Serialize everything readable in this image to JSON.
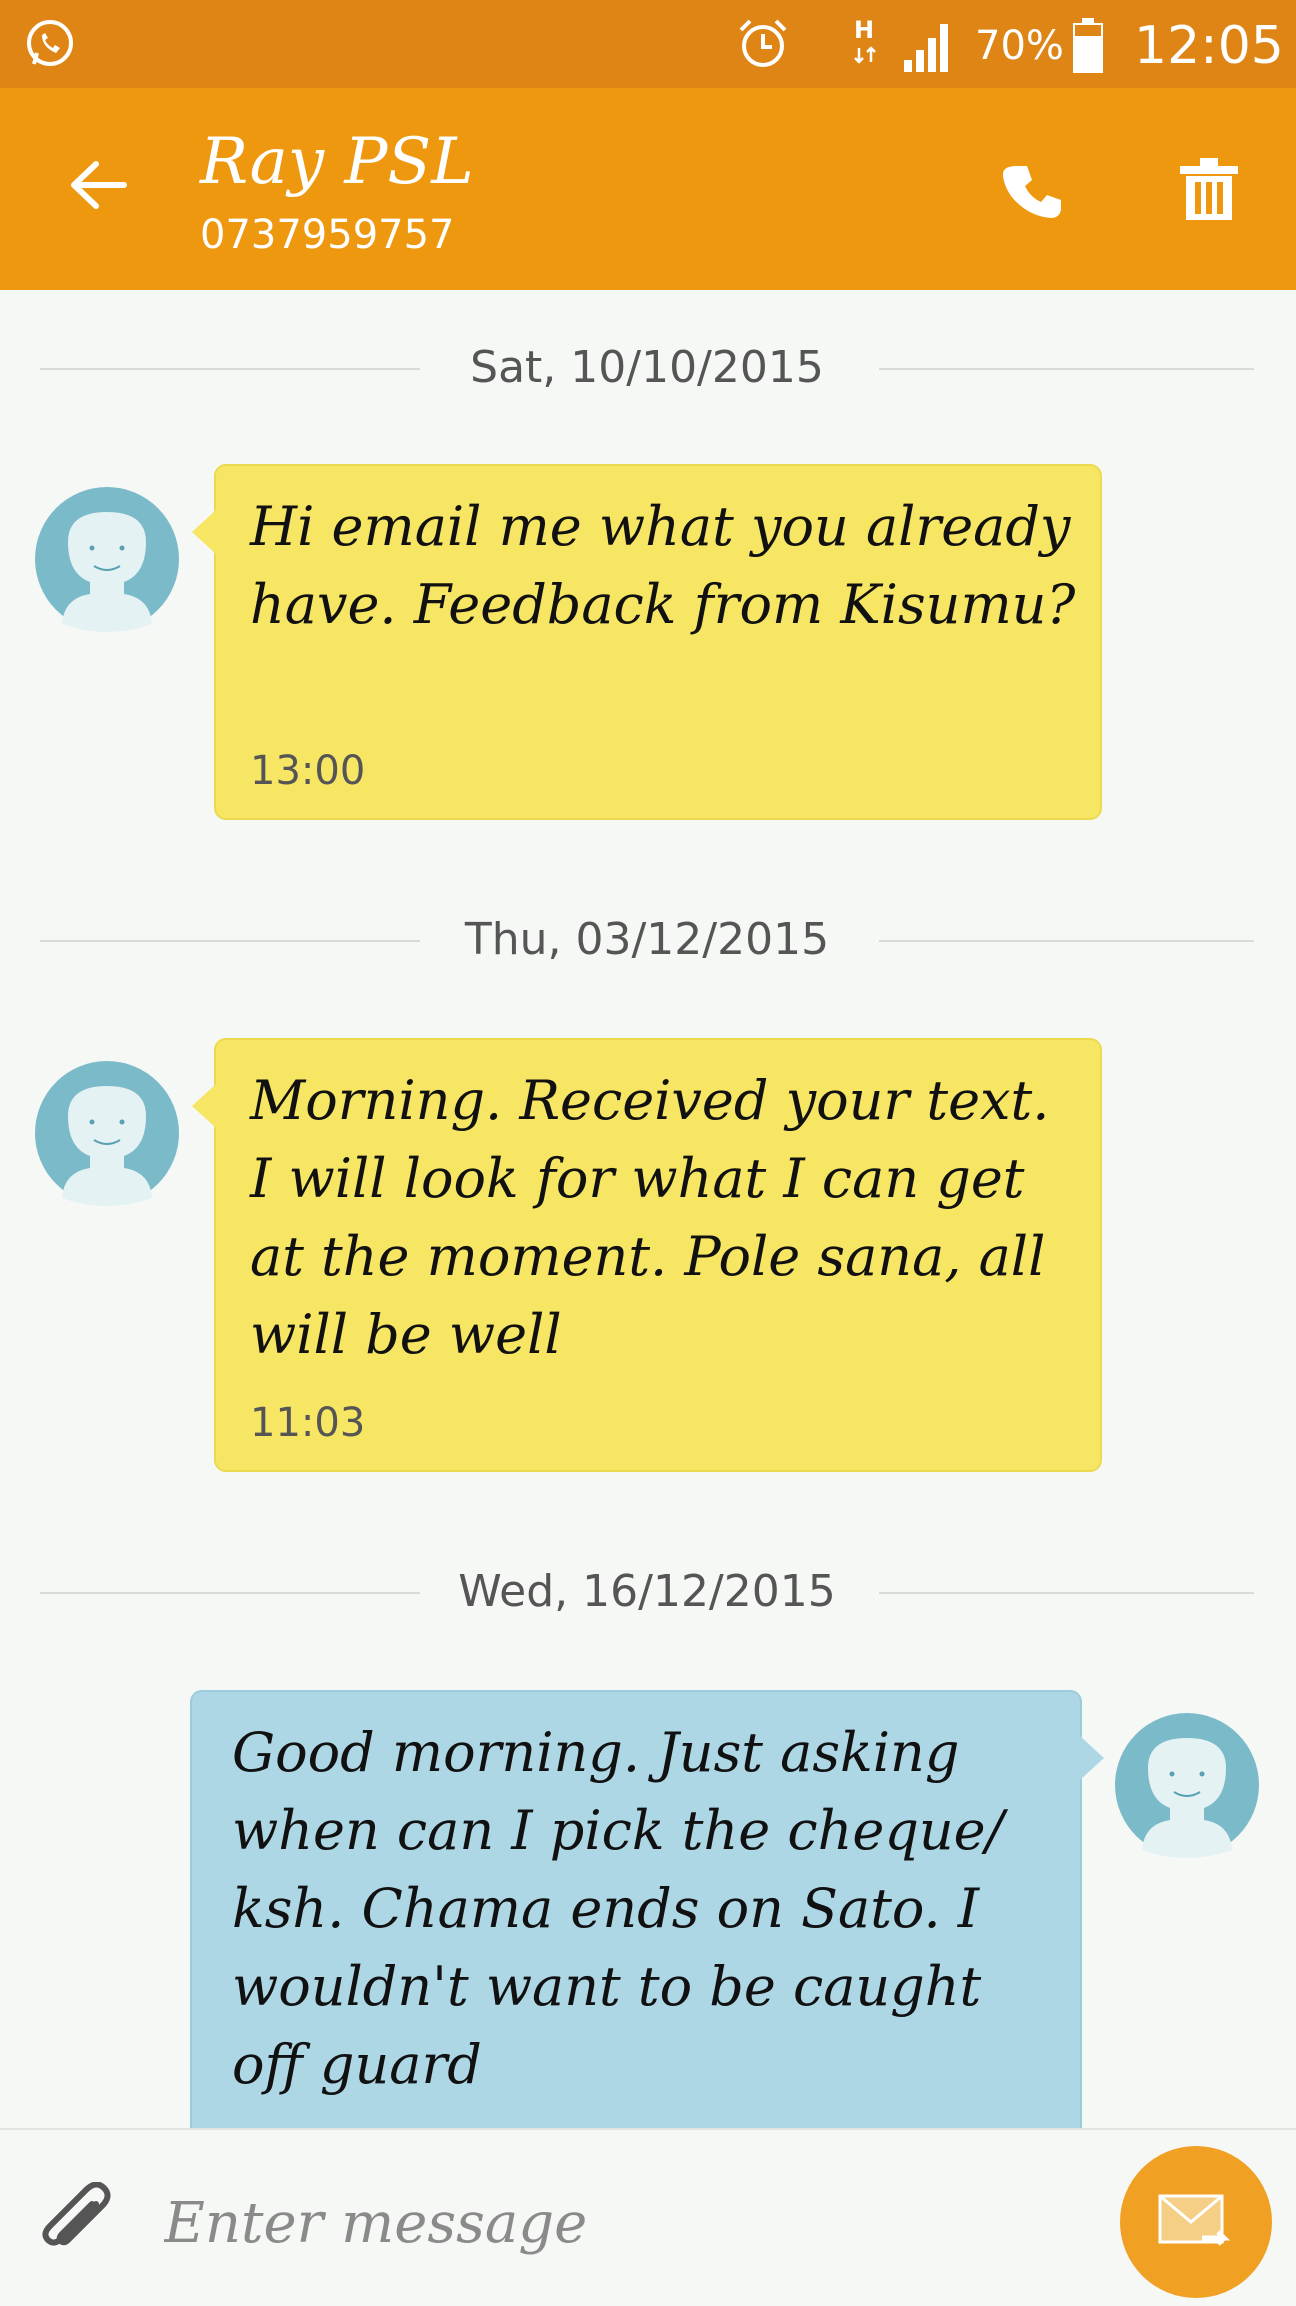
{
  "status_bar": {
    "battery_percent": "70%",
    "time": "12:05",
    "network_type": "H",
    "icons": [
      "whatsapp-icon",
      "alarm-icon",
      "hspa-icon",
      "signal-icon",
      "battery-icon"
    ]
  },
  "header": {
    "contact_name": "Ray PSL",
    "phone_number": "0737959757",
    "icons": [
      "back-arrow-icon",
      "phone-icon",
      "trash-icon"
    ]
  },
  "conversation": {
    "groups": [
      {
        "date": "Sat, 10/10/2015",
        "message": {
          "direction": "incoming",
          "text": "Hi email me what you already have. Feedback from Kisumu?",
          "time": "13:00"
        }
      },
      {
        "date": "Thu, 03/12/2015",
        "message": {
          "direction": "incoming",
          "text": "Morning. Received your text. I will look for what I can get at the moment. Pole sana, all will be well",
          "time": "11:03"
        }
      },
      {
        "date": "Wed, 16/12/2015",
        "message": {
          "direction": "outgoing",
          "text": "Good morning. Just asking when can I pick the cheque/ ksh. Chama ends on Sato. I wouldn't want to be caught off guard"
        }
      }
    ]
  },
  "composer": {
    "placeholder": "Enter message",
    "value": ""
  },
  "colors": {
    "status_bar": "#df8516",
    "app_bar": "#ee980f",
    "incoming_bubble": "#f7e564",
    "outgoing_bubble": "#aed7e6",
    "send_button": "#f0a023",
    "avatar": "#7bbac9"
  }
}
